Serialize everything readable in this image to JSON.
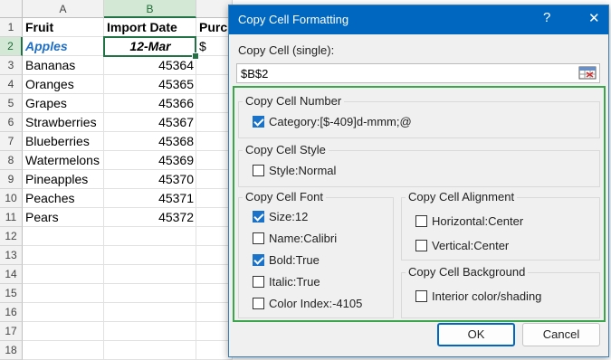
{
  "spreadsheet": {
    "columns": [
      "A",
      "B",
      "Purch"
    ],
    "rows": [
      "1",
      "2",
      "3",
      "4",
      "5",
      "6",
      "7",
      "8",
      "9",
      "10",
      "11",
      "12",
      "13",
      "14",
      "15",
      "16",
      "17",
      "18"
    ],
    "header": {
      "fruit": "Fruit",
      "import_date": "Import Date",
      "purch": "Purch"
    },
    "data": [
      {
        "fruit": "Apples",
        "date": "12-Mar",
        "extra": "$"
      },
      {
        "fruit": "Bananas",
        "date": "45364"
      },
      {
        "fruit": "Oranges",
        "date": "45365"
      },
      {
        "fruit": "Grapes",
        "date": "45366"
      },
      {
        "fruit": "Strawberries",
        "date": "45367"
      },
      {
        "fruit": "Blueberries",
        "date": "45368"
      },
      {
        "fruit": "Watermelons",
        "date": "45369"
      },
      {
        "fruit": "Pineapples",
        "date": "45370"
      },
      {
        "fruit": "Peaches",
        "date": "45371"
      },
      {
        "fruit": "Pears",
        "date": "45372"
      }
    ]
  },
  "dialog": {
    "title": "Copy Cell Formatting",
    "help": "?",
    "close": "✕",
    "copy_cell_label": "Copy Cell (single):",
    "copy_cell_value": "$B$2",
    "groups": {
      "number": {
        "title": "Copy Cell Number",
        "items": [
          {
            "label": "Category:[$-409]d-mmm;@",
            "checked": true
          }
        ]
      },
      "style": {
        "title": "Copy Cell Style",
        "items": [
          {
            "label": "Style:Normal",
            "checked": false
          }
        ]
      },
      "font": {
        "title": "Copy Cell Font",
        "items": [
          {
            "label": "Size:12",
            "checked": true
          },
          {
            "label": "Name:Calibri",
            "checked": false
          },
          {
            "label": "Bold:True",
            "checked": true
          },
          {
            "label": "Italic:True",
            "checked": false
          },
          {
            "label": "Color Index:-4105",
            "checked": false
          }
        ]
      },
      "alignment": {
        "title": "Copy Cell Alignment",
        "items": [
          {
            "label": "Horizontal:Center",
            "checked": false
          },
          {
            "label": "Vertical:Center",
            "checked": false
          }
        ]
      },
      "background": {
        "title": "Copy Cell Background",
        "items": [
          {
            "label": "Interior color/shading",
            "checked": false
          }
        ]
      }
    },
    "ok_label": "OK",
    "cancel_label": "Cancel",
    "accent_color": "#0067c0",
    "highlight_color": "#3aa54a"
  }
}
